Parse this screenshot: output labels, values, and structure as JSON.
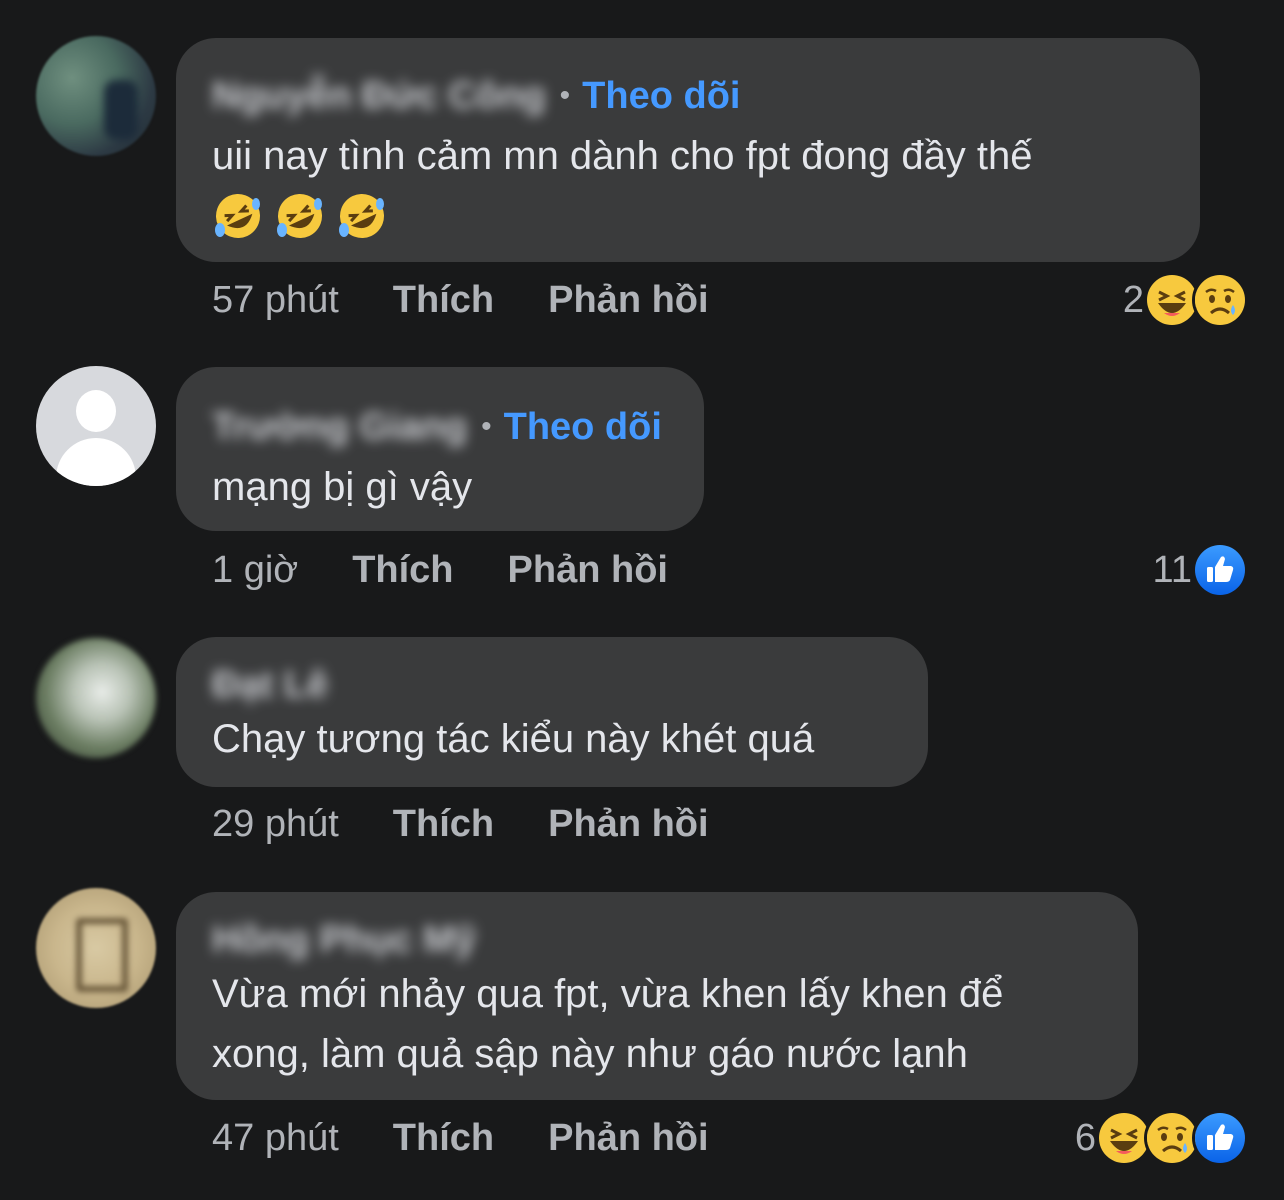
{
  "comments": [
    {
      "author": "Nguyễn Đức Công",
      "follow_label": "Theo dõi",
      "text": "uii nay tình cảm mn dành cho fpt đong đầy thế",
      "emojis": [
        "rofl-emoji",
        "rofl-emoji",
        "rofl-emoji"
      ],
      "time": "57 phút",
      "like_label": "Thích",
      "reply_label": "Phản hồi",
      "reaction_count": "2",
      "reactions": [
        "haha-icon",
        "sad-icon"
      ]
    },
    {
      "author": "Trường Giang",
      "follow_label": "Theo dõi",
      "text": "mạng bị gì vậy",
      "time": "1 giờ",
      "like_label": "Thích",
      "reply_label": "Phản hồi",
      "reaction_count": "11",
      "reactions": [
        "like-icon"
      ]
    },
    {
      "author": "Đạt Lê",
      "text": "Chạy tương tác kiểu này khét quá",
      "time": "29 phút",
      "like_label": "Thích",
      "reply_label": "Phản hồi"
    },
    {
      "author": "Hồng Phục Mỹ",
      "text_line1": "Vừa mới nhảy qua fpt, vừa khen lấy khen để",
      "text_line2": "xong, làm quả sập này như gáo nước lạnh",
      "time": "47 phút",
      "like_label": "Thích",
      "reply_label": "Phản hồi",
      "reaction_count": "6",
      "reactions": [
        "haha-icon",
        "sad-icon",
        "like-icon"
      ]
    }
  ],
  "colors": {
    "background": "#18191a",
    "bubble": "#3a3b3c",
    "link": "#4599ff",
    "secondary_text": "#b0b3b8",
    "primary_text": "#e4e6eb",
    "like_blue": "#1877f2",
    "emoji_yellow": "#f7c93e"
  }
}
